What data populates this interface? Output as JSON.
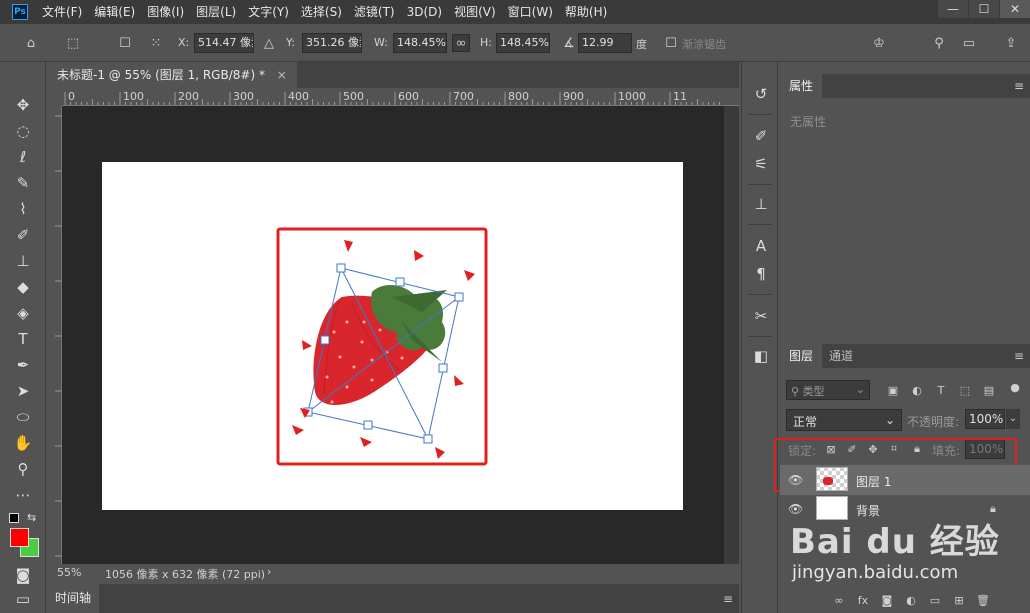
{
  "app": {
    "logo": "Ps"
  },
  "menu": [
    "文件(F)",
    "编辑(E)",
    "图像(I)",
    "图层(L)",
    "文字(Y)",
    "选择(S)",
    "滤镜(T)",
    "3D(D)",
    "视图(V)",
    "窗口(W)",
    "帮助(H)"
  ],
  "window_controls": {
    "minimize": "—",
    "maximize": "☐",
    "close": "✕"
  },
  "options": {
    "x_label": "X:",
    "x_value": "514.47 像素",
    "y_label": "Y:",
    "y_value": "351.26 像素",
    "w_label": "W:",
    "w_value": "148.45%",
    "h_label": "H:",
    "h_value": "148.45%",
    "angle_value": "12.99",
    "angle_unit": "度",
    "interp_label": "渐涂锯齿"
  },
  "document": {
    "tab_title": "未标题-1 @ 55% (图层 1, RGB/8#) *",
    "close": "×",
    "zoom": "55%",
    "doc_info": "1056 像素 x 632 像素 (72 ppi)",
    "timeline_label": "时间轴"
  },
  "ruler_ticks": [
    "0",
    "100",
    "200",
    "300",
    "400",
    "500",
    "600",
    "700",
    "800",
    "900",
    "1000",
    "11"
  ],
  "properties_panel": {
    "tab": "属性",
    "empty_text": "无属性"
  },
  "layers_panel": {
    "tabs": [
      "图层",
      "通道"
    ],
    "filter_label": "类型",
    "blend_mode": "正常",
    "opacity_label": "不透明度:",
    "opacity_value": "100%",
    "lock_label": "锁定:",
    "fill_label": "填充:",
    "fill_value": "100%",
    "layers": [
      {
        "name": "图层 1"
      },
      {
        "name": "背景"
      }
    ]
  },
  "watermark": {
    "brand": "Bai du 经验",
    "url": "jingyan.baidu.com"
  },
  "colors": {
    "highlight": "#e0201c",
    "foreground": "#ff0000",
    "background": "#4ccc44",
    "handle": "#3f77c9"
  }
}
